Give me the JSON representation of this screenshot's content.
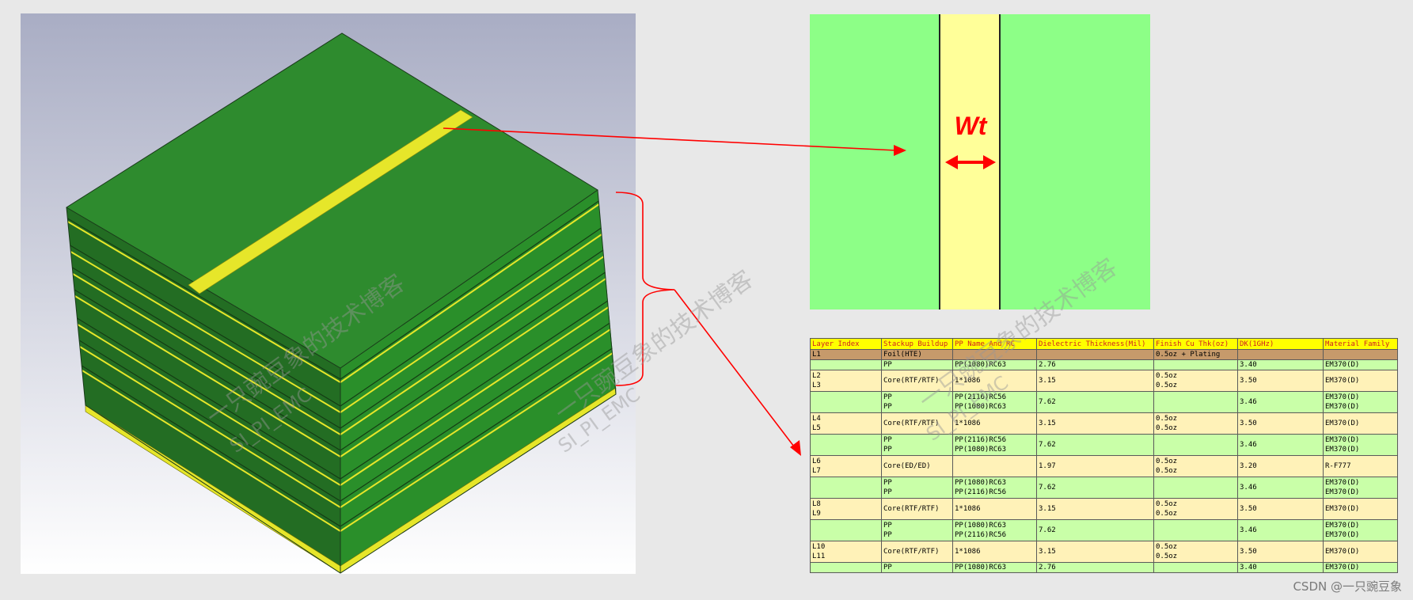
{
  "colors": {
    "board_top": "#2e8b2e",
    "board_left": "#236d23",
    "board_right": "#2a8f2a",
    "trace": "#e6e62a",
    "closeup_bg": "#8dff87",
    "closeup_trace": "#ffff99",
    "annotation": "#ff0000",
    "header_bg": "#ffff00",
    "foil_bg": "#c69a6b",
    "core_bg": "#fff2b8",
    "pp_bg": "#c9ffa8"
  },
  "closeup": {
    "label": "Wt"
  },
  "watermarks": {
    "cn": "一只豌豆象的技术博客",
    "en": "SI_PI_EMC"
  },
  "credit": "CSDN @一只豌豆象",
  "table": {
    "headers": [
      "Layer Index",
      "Stackup Buildup",
      "PP Name And RC",
      "Dielectric Thickness(Mil)",
      "Finish Cu Thk(oz)",
      "DK(1GHz)",
      "Material Family"
    ],
    "rows": [
      {
        "kind": "foil",
        "layer": [
          "L1"
        ],
        "buildup": [
          "Foil(HTE)"
        ],
        "pp": [
          ""
        ],
        "thickness": [
          ""
        ],
        "cu": [
          "0.5oz + Plating"
        ],
        "dk": [
          ""
        ],
        "family": [
          ""
        ]
      },
      {
        "kind": "pp1",
        "layer": [
          ""
        ],
        "buildup": [
          "PP"
        ],
        "pp": [
          "PP(1080)RC63"
        ],
        "thickness": [
          "2.76"
        ],
        "cu": [
          ""
        ],
        "dk": [
          "3.40"
        ],
        "family": [
          "EM370(D)"
        ]
      },
      {
        "kind": "core",
        "layer": [
          "L2",
          "L3"
        ],
        "buildup": [
          "Core(RTF/RTF)"
        ],
        "pp": [
          "1*1086"
        ],
        "thickness": [
          "3.15"
        ],
        "cu": [
          "0.5oz",
          "0.5oz"
        ],
        "dk": [
          "3.50"
        ],
        "family": [
          "EM370(D)"
        ]
      },
      {
        "kind": "pp",
        "layer": [
          ""
        ],
        "buildup": [
          "PP",
          "PP"
        ],
        "pp": [
          "PP(2116)RC56",
          "PP(1080)RC63"
        ],
        "thickness": [
          "7.62"
        ],
        "cu": [
          ""
        ],
        "dk": [
          "3.46"
        ],
        "family": [
          "EM370(D)",
          "EM370(D)"
        ]
      },
      {
        "kind": "core",
        "layer": [
          "L4",
          "L5"
        ],
        "buildup": [
          "Core(RTF/RTF)"
        ],
        "pp": [
          "1*1086"
        ],
        "thickness": [
          "3.15"
        ],
        "cu": [
          "0.5oz",
          "0.5oz"
        ],
        "dk": [
          "3.50"
        ],
        "family": [
          "EM370(D)"
        ]
      },
      {
        "kind": "pp",
        "layer": [
          ""
        ],
        "buildup": [
          "PP",
          "PP"
        ],
        "pp": [
          "PP(2116)RC56",
          "PP(1080)RC63"
        ],
        "thickness": [
          "7.62"
        ],
        "cu": [
          ""
        ],
        "dk": [
          "3.46"
        ],
        "family": [
          "EM370(D)",
          "EM370(D)"
        ]
      },
      {
        "kind": "core",
        "layer": [
          "L6",
          "L7"
        ],
        "buildup": [
          "Core(ED/ED)"
        ],
        "pp": [
          ""
        ],
        "thickness": [
          "1.97"
        ],
        "cu": [
          "0.5oz",
          "0.5oz"
        ],
        "dk": [
          "3.20"
        ],
        "family": [
          "R-F777"
        ]
      },
      {
        "kind": "pp",
        "layer": [
          ""
        ],
        "buildup": [
          "PP",
          "PP"
        ],
        "pp": [
          "PP(1080)RC63",
          "PP(2116)RC56"
        ],
        "thickness": [
          "7.62"
        ],
        "cu": [
          ""
        ],
        "dk": [
          "3.46"
        ],
        "family": [
          "EM370(D)",
          "EM370(D)"
        ]
      },
      {
        "kind": "core",
        "layer": [
          "L8",
          "L9"
        ],
        "buildup": [
          "Core(RTF/RTF)"
        ],
        "pp": [
          "1*1086"
        ],
        "thickness": [
          "3.15"
        ],
        "cu": [
          "0.5oz",
          "0.5oz"
        ],
        "dk": [
          "3.50"
        ],
        "family": [
          "EM370(D)"
        ]
      },
      {
        "kind": "pp",
        "layer": [
          ""
        ],
        "buildup": [
          "PP",
          "PP"
        ],
        "pp": [
          "PP(1080)RC63",
          "PP(2116)RC56"
        ],
        "thickness": [
          "7.62"
        ],
        "cu": [
          ""
        ],
        "dk": [
          "3.46"
        ],
        "family": [
          "EM370(D)",
          "EM370(D)"
        ]
      },
      {
        "kind": "core",
        "layer": [
          "L10",
          "L11"
        ],
        "buildup": [
          "Core(RTF/RTF)"
        ],
        "pp": [
          "1*1086"
        ],
        "thickness": [
          "3.15"
        ],
        "cu": [
          "0.5oz",
          "0.5oz"
        ],
        "dk": [
          "3.50"
        ],
        "family": [
          "EM370(D)"
        ]
      },
      {
        "kind": "pp1",
        "layer": [
          ""
        ],
        "buildup": [
          "PP"
        ],
        "pp": [
          "PP(1080)RC63"
        ],
        "thickness": [
          "2.76"
        ],
        "cu": [
          ""
        ],
        "dk": [
          "3.40"
        ],
        "family": [
          "EM370(D)"
        ]
      }
    ]
  }
}
